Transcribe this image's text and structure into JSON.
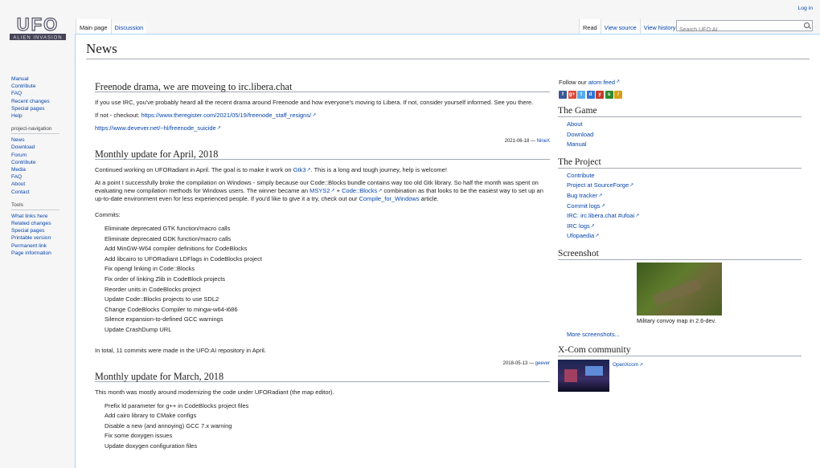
{
  "header": {
    "login": "Log in",
    "tabs_left": [
      "Main page",
      "Discussion"
    ],
    "tabs_right": [
      "Read",
      "View source",
      "View history"
    ],
    "search_placeholder": "Search UFO:AI"
  },
  "sidebar": {
    "main": [
      "Manual",
      "Contribute",
      "FAQ",
      "Recent changes",
      "Special pages",
      "Help"
    ],
    "nav_title": "project-navigation",
    "nav": [
      "News",
      "Download",
      "Forum",
      "Contribute",
      "Media",
      "FAQ",
      "About",
      "Contact"
    ],
    "tools_title": "Tools",
    "tools": [
      "What links here",
      "Related changes",
      "Special pages",
      "Printable version",
      "Permanent link",
      "Page information"
    ]
  },
  "page": {
    "title": "News"
  },
  "news": [
    {
      "heading": "Freenode drama, we are moveing to irc.libera.chat",
      "p1": "If you use IRC, you've probably heard all the recent drama around Freenode and how everyone's moving to Libera. If not, consider yourself informed. See you there.",
      "p2_text": "If not - checkout: ",
      "p2_link": "https://www.theregister.com/2021/05/19/freenode_staff_resigns/",
      "p3_link": "https://www.devever.net/~hl/freenode_suicide",
      "sig_date": "2021-06-18 —",
      "sig_user": "NineX"
    },
    {
      "heading": "Monthly update for April, 2018",
      "p1_a": "Continued working on UFORadiant in April. The goal is to make it work on ",
      "p1_link": "Gtk3",
      "p1_b": ". This is a long and tough journey, help is welcome!",
      "p2_a": "At a point I successfully broke the compilation on Windows - simply because our Code::Blocks bundle contains way too old Gtk library. So half the month was spent on evaluating new compilation methods for Windows users. The winner became an ",
      "p2_link1": "MSYS2",
      "p2_b": " + ",
      "p2_link2": "Code::Blocks",
      "p2_c": " combination as that looks to be the easiest way to set up an up-to-date environment even for less experienced people. If you'd like to give it a try, check out our ",
      "p2_link3": "Compile_for_Windows",
      "p2_d": " article.",
      "commits_label": "Commits:",
      "commits": [
        "Eliminate deprecated GTK function/macro calls",
        "Eliminate deprecated GDK function/macro calls",
        "Add MinGW-W64 compiler definitions for CodeBlocks",
        "Add libcairo to UFORadiant LDFlags in CodeBlocks project",
        "Fix opengl linking in Code::Blocks",
        "Fix order of linking Zlib in CodeBlock projects",
        "Reorder units in CodeBlocks project",
        "Update Code::Blocks projects to use SDL2",
        "Change CodeBlocks Compiler to mingw-w64-i686",
        "Silence expansion-to-defined GCC warnings",
        "Update CrashDump URL"
      ],
      "total": "In total, 11 commits were made in the UFO:AI repository in April.",
      "sig_date": "2018-05-13 —",
      "sig_user": "geever"
    },
    {
      "heading": "Monthly update for March, 2018",
      "p1": "This month was mostly around modernizing the code under UFORadiant (the map editor).",
      "commits": [
        "Prefix ld parameter for g++ in CodeBlocks project files",
        "Add cairo library to CMake configs",
        "Disable a new (and annoying) GCC 7.x warning",
        "Fix some doxygen issues",
        "Update doxygen configuration files"
      ]
    }
  ],
  "aside": {
    "follow_text": "Follow our ",
    "follow_link": "atom feed",
    "social_icons": [
      {
        "name": "facebook-icon",
        "glyph": "f",
        "color": "#3b5998"
      },
      {
        "name": "google-plus-icon",
        "glyph": "g+",
        "color": "#dd4b39"
      },
      {
        "name": "twitter-icon",
        "glyph": "t",
        "color": "#55acee"
      },
      {
        "name": "delicious-icon",
        "glyph": "d",
        "color": "#3274d2"
      },
      {
        "name": "digg-icon",
        "glyph": "y",
        "color": "#c0392b"
      },
      {
        "name": "stumbleupon-icon",
        "glyph": "s",
        "color": "#2e8b2e"
      },
      {
        "name": "slashdot-icon",
        "glyph": "/",
        "color": "#d4a017"
      }
    ],
    "game_title": "The Game",
    "game_links": [
      "About",
      "Download",
      "Manual"
    ],
    "project_title": "The Project",
    "project_links": [
      "Contribute",
      "Project at SourceForge",
      "Bug tracker",
      "Commit logs",
      "IRC: irc.libera.chat #ufoai",
      "IRC logs",
      "Ufopaedia"
    ],
    "screenshot_title": "Screenshot",
    "screenshot_caption": "Military convoy map in 2.6-dev.",
    "more_screenshots": "More screenshots...",
    "xcom_title": "X-Com community",
    "xcom_link": "OpenXcom"
  }
}
